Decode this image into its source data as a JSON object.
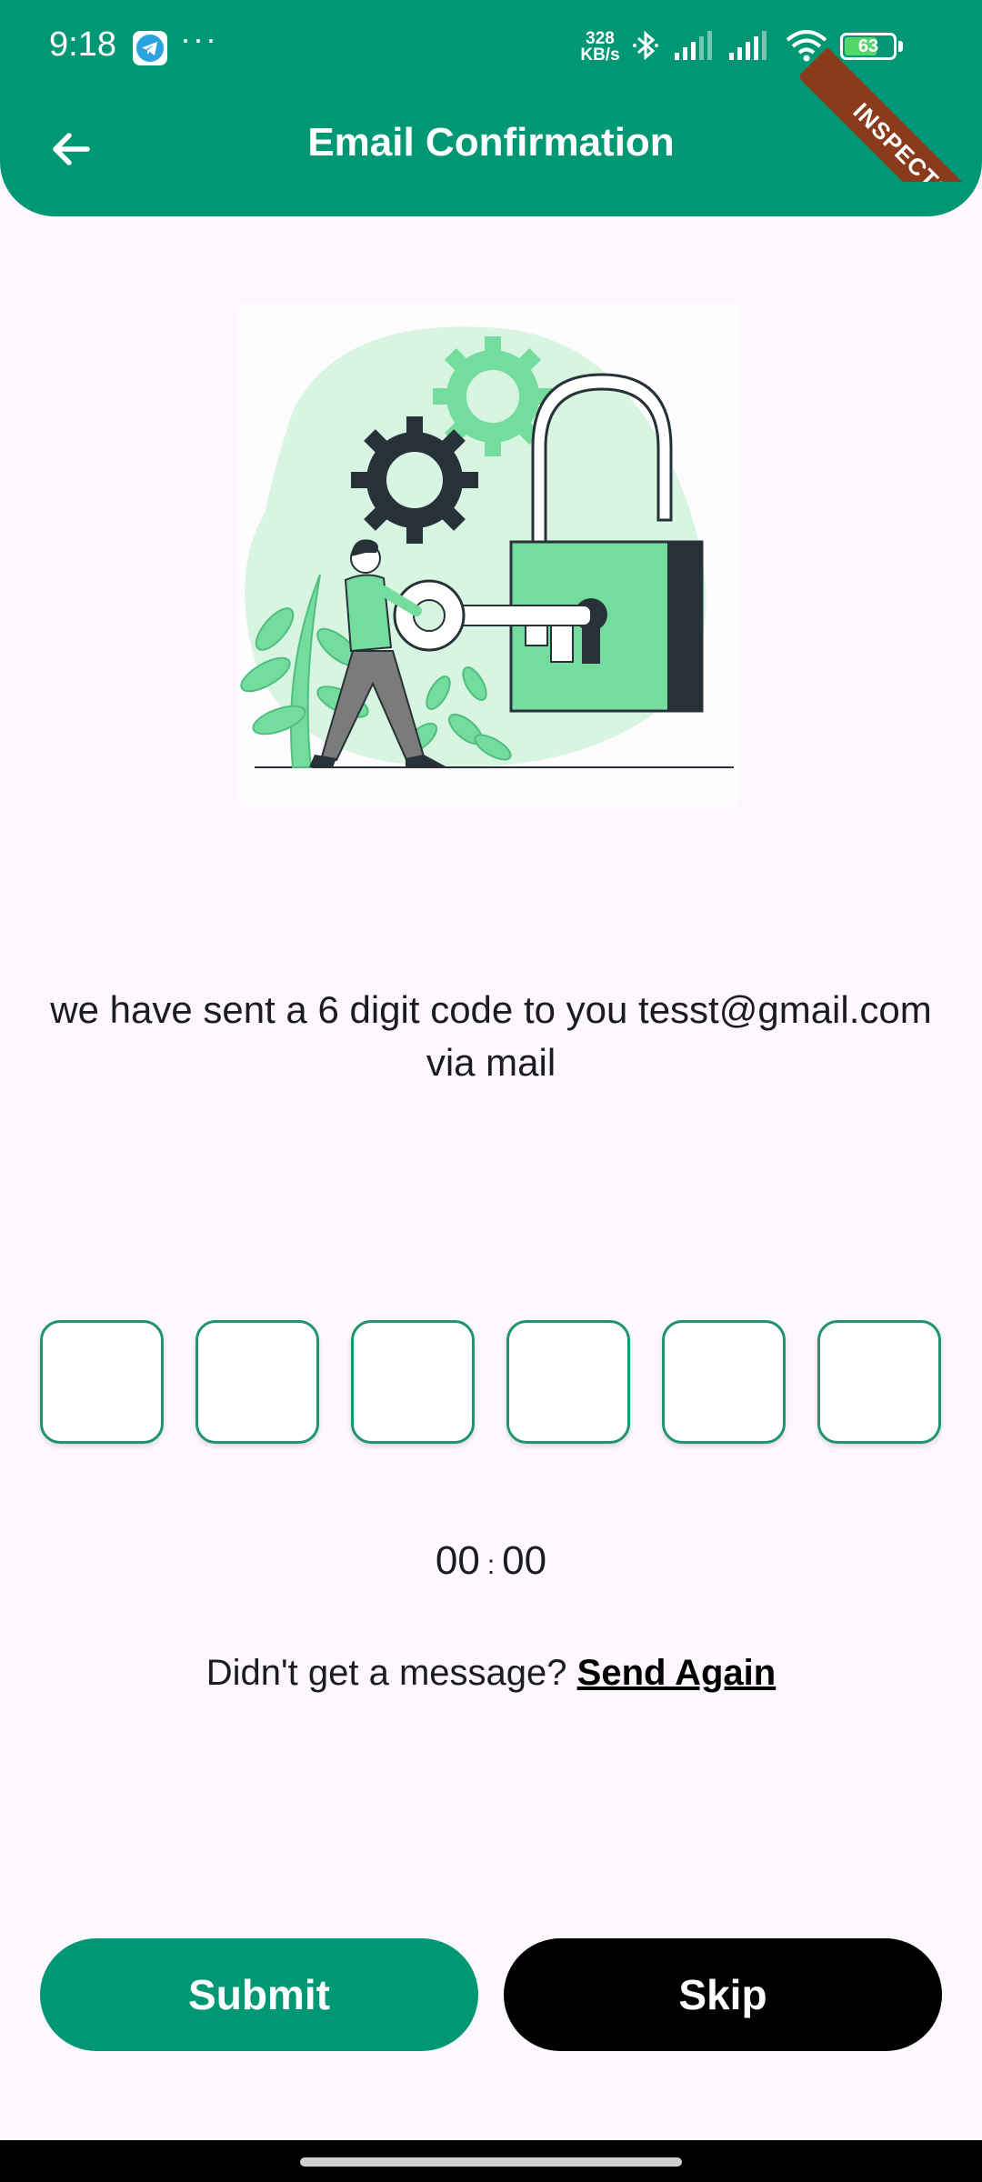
{
  "status_bar": {
    "time": "9:18",
    "notification_overflow": "···",
    "net_speed_value": "328",
    "net_speed_unit": "KB/s",
    "battery_level": "63",
    "icons": [
      "telegram-icon",
      "bluetooth-icon",
      "signal-icon",
      "signal-icon",
      "wifi-icon",
      "battery-icon"
    ]
  },
  "debug_ribbon": "INSPECTOR",
  "app_bar": {
    "back_icon": "arrow-left-icon",
    "title": "Email Confirmation"
  },
  "illustration": {
    "description_icon": "padlock-key-illustration"
  },
  "message": {
    "text": "we have sent a 6 digit code to you tesst@gmail.com via mail"
  },
  "otp": {
    "length": 6,
    "digits": [
      "",
      "",
      "",
      "",
      "",
      ""
    ]
  },
  "timer": {
    "minutes": "00",
    "separator": ":",
    "seconds": "00"
  },
  "resend": {
    "prompt": "Didn't get a message? ",
    "link_label": "Send Again"
  },
  "buttons": {
    "submit_label": "Submit",
    "skip_label": "Skip"
  },
  "colors": {
    "primary": "#009874",
    "otp_border": "#20936f",
    "skip_button": "#000000",
    "background": "#fdf8fd",
    "ribbon": "#8a3b1c"
  }
}
